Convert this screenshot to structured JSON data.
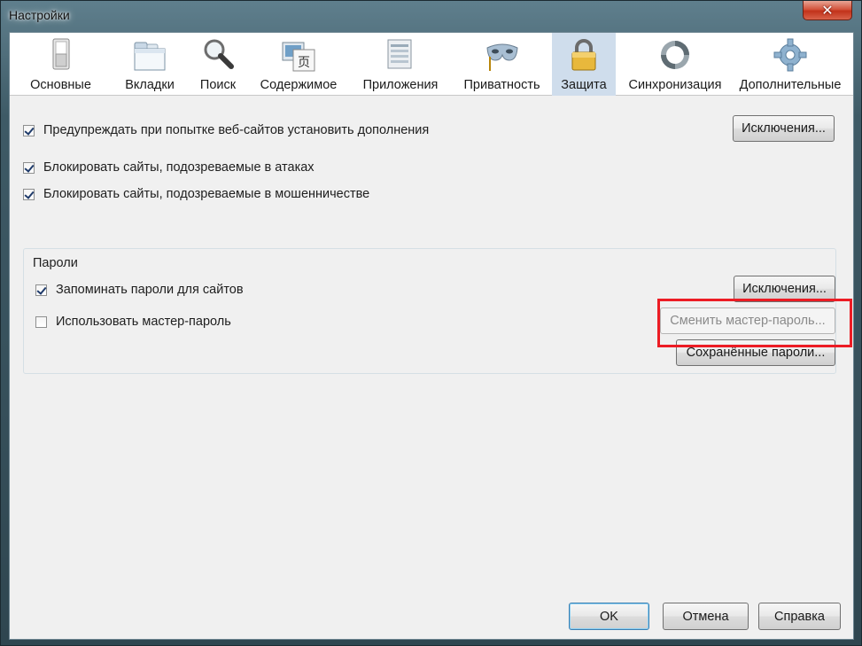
{
  "window": {
    "title": "Настройки",
    "close_glyph": "✕"
  },
  "tabs": [
    {
      "label": "Основные",
      "icon": "switch-icon",
      "selected": false
    },
    {
      "label": "Вкладки",
      "icon": "tabs-icon",
      "selected": false
    },
    {
      "label": "Поиск",
      "icon": "magnifier-icon",
      "selected": false
    },
    {
      "label": "Содержимое",
      "icon": "content-icon",
      "selected": false
    },
    {
      "label": "Приложения",
      "icon": "applications-icon",
      "selected": false
    },
    {
      "label": "Приватность",
      "icon": "mask-icon",
      "selected": false
    },
    {
      "label": "Защита",
      "icon": "padlock-icon",
      "selected": true
    },
    {
      "label": "Синхронизация",
      "icon": "sync-icon",
      "selected": false
    },
    {
      "label": "Дополнительные",
      "icon": "gear-icon",
      "selected": false
    }
  ],
  "security": {
    "warn_addons": {
      "label": "Предупреждать при попытке веб-сайтов установить дополнения",
      "checked": true
    },
    "addons_exceptions": "Исключения...",
    "block_attack": {
      "label": "Блокировать сайты, подозреваемые в атаках",
      "checked": true
    },
    "block_forgery": {
      "label": "Блокировать сайты, подозреваемые в мошенничестве",
      "checked": true
    }
  },
  "passwords": {
    "group_title": "Пароли",
    "remember": {
      "label": "Запоминать пароли для сайтов",
      "checked": true
    },
    "exceptions": "Исключения...",
    "master": {
      "label": "Использовать мастер-пароль",
      "checked": false
    },
    "change_master": "Сменить мастер-пароль...",
    "saved": "Сохранённые пароли..."
  },
  "footer": {
    "ok": "OK",
    "cancel": "Отмена",
    "help": "Справка"
  },
  "colors": {
    "selected_tab": "#cfddec",
    "highlight": "#ec1c24"
  }
}
